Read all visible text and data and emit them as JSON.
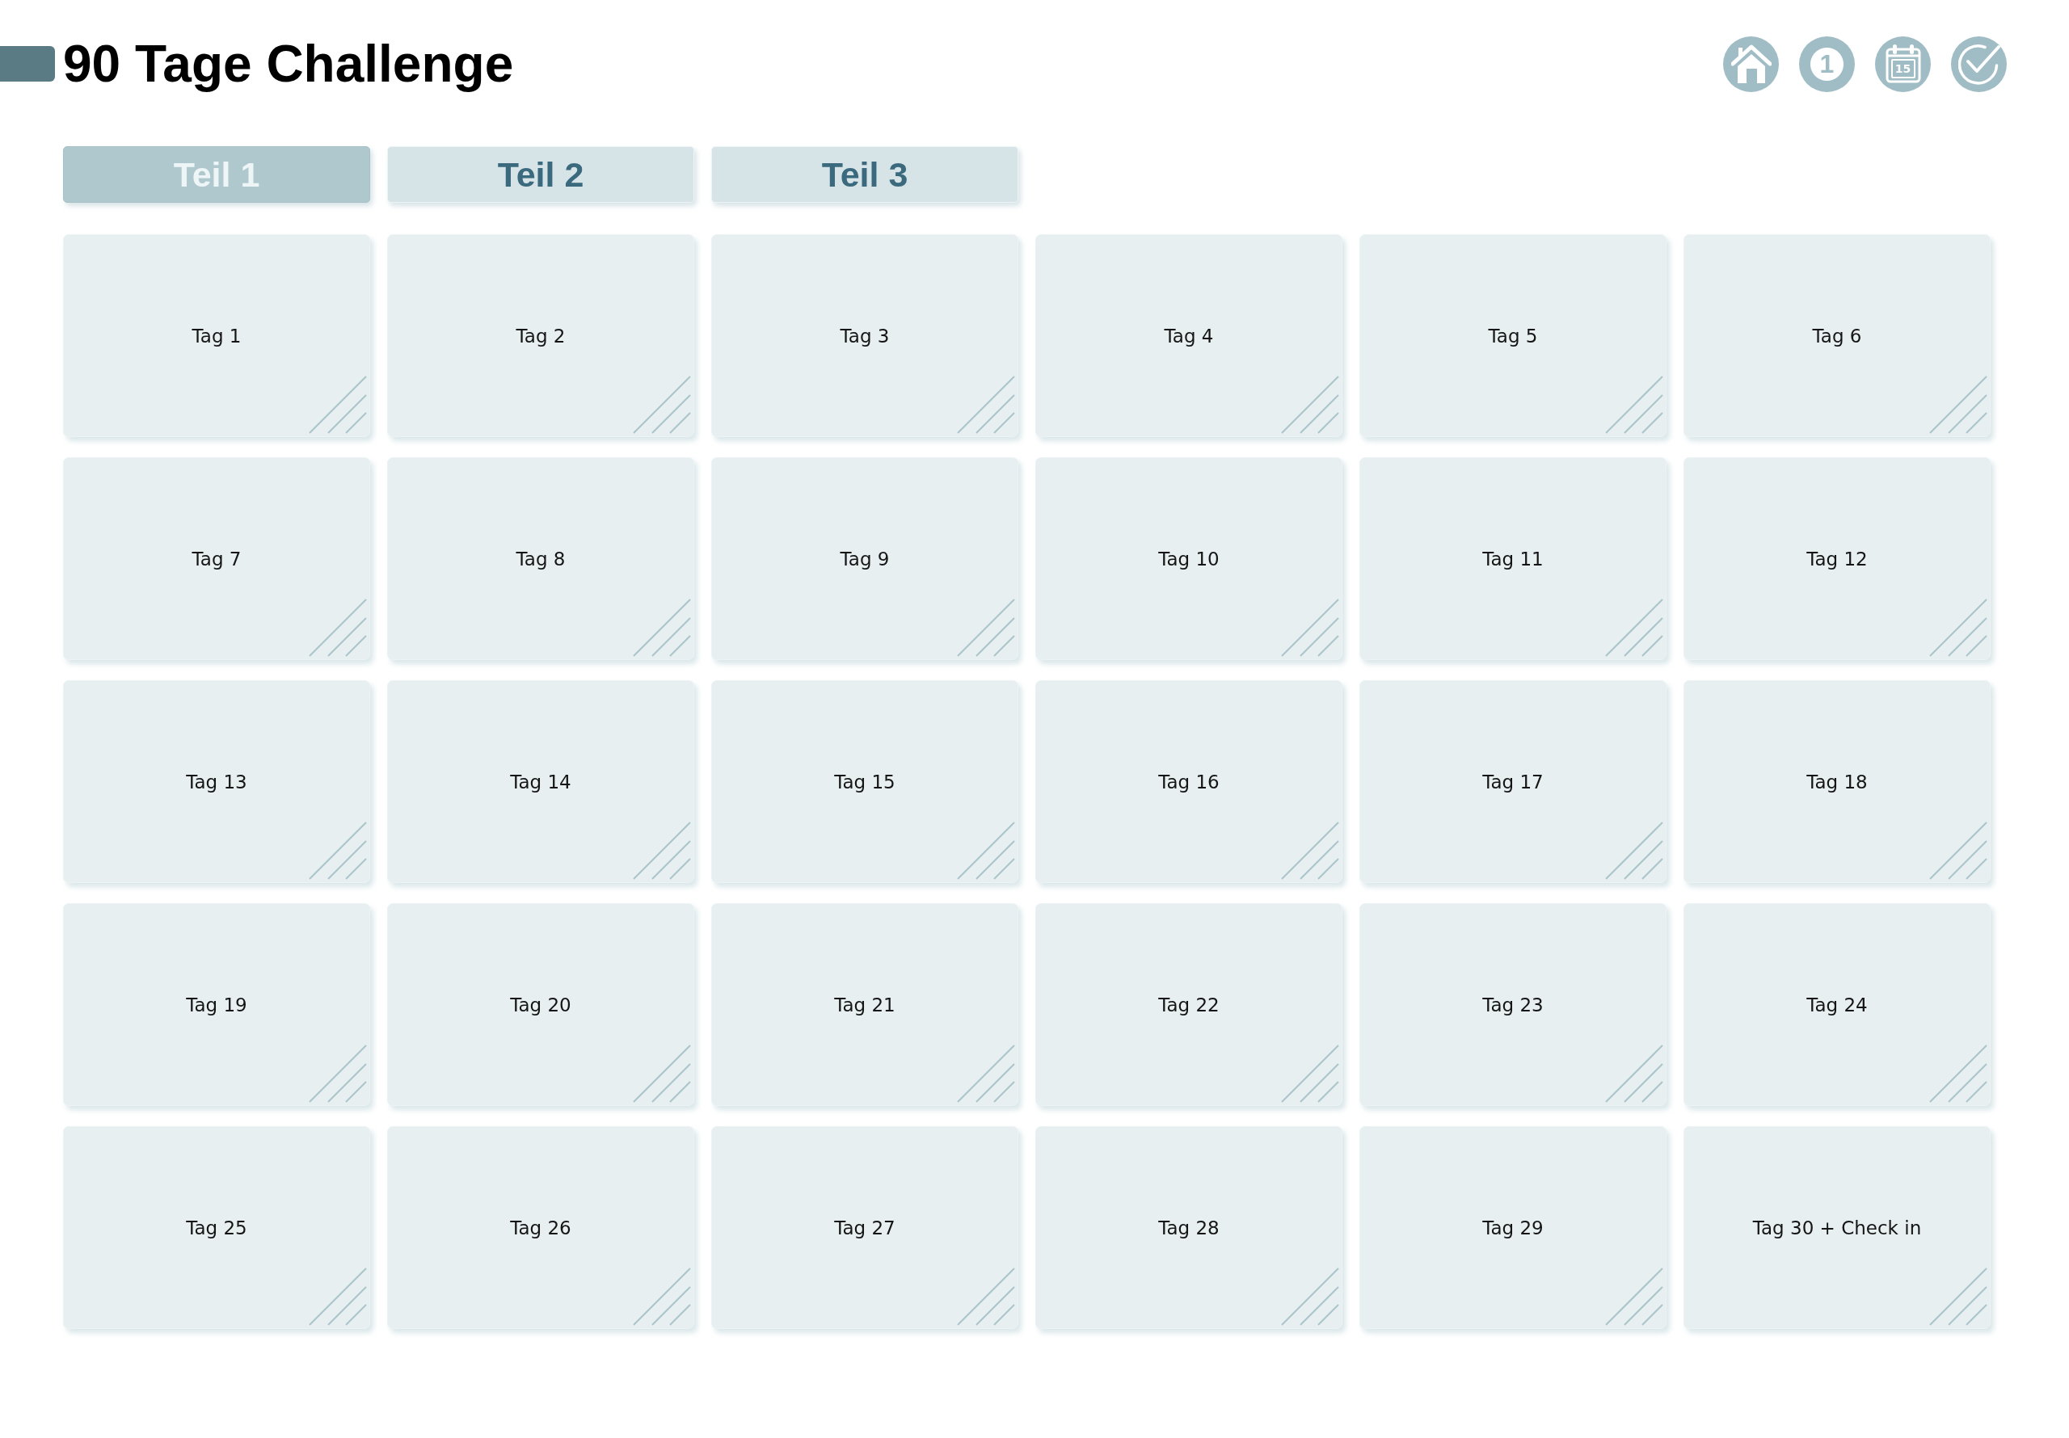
{
  "header": {
    "title": "90 Tage Challenge"
  },
  "nav_icons": [
    {
      "kind": "home"
    },
    {
      "kind": "number",
      "label": "1"
    },
    {
      "kind": "calendar",
      "label": "15"
    },
    {
      "kind": "check"
    }
  ],
  "tabs": [
    {
      "label": "Teil 1",
      "selected": true
    },
    {
      "label": "Teil 2",
      "selected": false
    },
    {
      "label": "Teil 3",
      "selected": false
    }
  ],
  "days": [
    "Tag 1",
    "Tag 2",
    "Tag 3",
    "Tag 4",
    "Tag 5",
    "Tag 6",
    "Tag 7",
    "Tag 8",
    "Tag 9",
    "Tag 10",
    "Tag 11",
    "Tag 12",
    "Tag 13",
    "Tag 14",
    "Tag 15",
    "Tag 16",
    "Tag 17",
    "Tag 18",
    "Tag 19",
    "Tag 20",
    "Tag 21",
    "Tag 22",
    "Tag 23",
    "Tag 24",
    "Tag 25",
    "Tag 26",
    "Tag 27",
    "Tag 28",
    "Tag 29",
    "Tag 30 + Check in"
  ]
}
